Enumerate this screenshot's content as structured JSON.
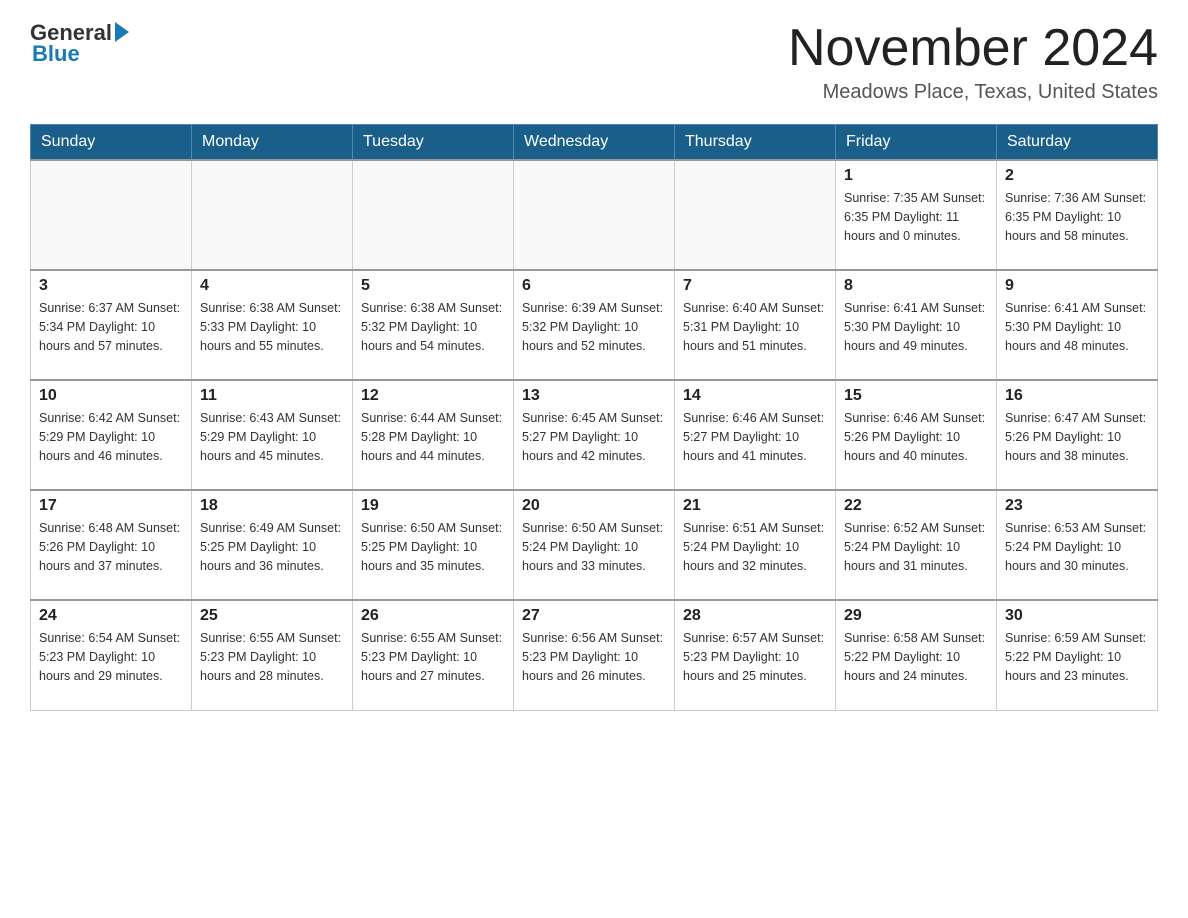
{
  "header": {
    "logo": {
      "general": "General",
      "blue": "Blue"
    },
    "title": "November 2024",
    "location": "Meadows Place, Texas, United States"
  },
  "weekdays": [
    "Sunday",
    "Monday",
    "Tuesday",
    "Wednesday",
    "Thursday",
    "Friday",
    "Saturday"
  ],
  "weeks": [
    [
      {
        "day": "",
        "info": ""
      },
      {
        "day": "",
        "info": ""
      },
      {
        "day": "",
        "info": ""
      },
      {
        "day": "",
        "info": ""
      },
      {
        "day": "",
        "info": ""
      },
      {
        "day": "1",
        "info": "Sunrise: 7:35 AM\nSunset: 6:35 PM\nDaylight: 11 hours and 0 minutes."
      },
      {
        "day": "2",
        "info": "Sunrise: 7:36 AM\nSunset: 6:35 PM\nDaylight: 10 hours and 58 minutes."
      }
    ],
    [
      {
        "day": "3",
        "info": "Sunrise: 6:37 AM\nSunset: 5:34 PM\nDaylight: 10 hours and 57 minutes."
      },
      {
        "day": "4",
        "info": "Sunrise: 6:38 AM\nSunset: 5:33 PM\nDaylight: 10 hours and 55 minutes."
      },
      {
        "day": "5",
        "info": "Sunrise: 6:38 AM\nSunset: 5:32 PM\nDaylight: 10 hours and 54 minutes."
      },
      {
        "day": "6",
        "info": "Sunrise: 6:39 AM\nSunset: 5:32 PM\nDaylight: 10 hours and 52 minutes."
      },
      {
        "day": "7",
        "info": "Sunrise: 6:40 AM\nSunset: 5:31 PM\nDaylight: 10 hours and 51 minutes."
      },
      {
        "day": "8",
        "info": "Sunrise: 6:41 AM\nSunset: 5:30 PM\nDaylight: 10 hours and 49 minutes."
      },
      {
        "day": "9",
        "info": "Sunrise: 6:41 AM\nSunset: 5:30 PM\nDaylight: 10 hours and 48 minutes."
      }
    ],
    [
      {
        "day": "10",
        "info": "Sunrise: 6:42 AM\nSunset: 5:29 PM\nDaylight: 10 hours and 46 minutes."
      },
      {
        "day": "11",
        "info": "Sunrise: 6:43 AM\nSunset: 5:29 PM\nDaylight: 10 hours and 45 minutes."
      },
      {
        "day": "12",
        "info": "Sunrise: 6:44 AM\nSunset: 5:28 PM\nDaylight: 10 hours and 44 minutes."
      },
      {
        "day": "13",
        "info": "Sunrise: 6:45 AM\nSunset: 5:27 PM\nDaylight: 10 hours and 42 minutes."
      },
      {
        "day": "14",
        "info": "Sunrise: 6:46 AM\nSunset: 5:27 PM\nDaylight: 10 hours and 41 minutes."
      },
      {
        "day": "15",
        "info": "Sunrise: 6:46 AM\nSunset: 5:26 PM\nDaylight: 10 hours and 40 minutes."
      },
      {
        "day": "16",
        "info": "Sunrise: 6:47 AM\nSunset: 5:26 PM\nDaylight: 10 hours and 38 minutes."
      }
    ],
    [
      {
        "day": "17",
        "info": "Sunrise: 6:48 AM\nSunset: 5:26 PM\nDaylight: 10 hours and 37 minutes."
      },
      {
        "day": "18",
        "info": "Sunrise: 6:49 AM\nSunset: 5:25 PM\nDaylight: 10 hours and 36 minutes."
      },
      {
        "day": "19",
        "info": "Sunrise: 6:50 AM\nSunset: 5:25 PM\nDaylight: 10 hours and 35 minutes."
      },
      {
        "day": "20",
        "info": "Sunrise: 6:50 AM\nSunset: 5:24 PM\nDaylight: 10 hours and 33 minutes."
      },
      {
        "day": "21",
        "info": "Sunrise: 6:51 AM\nSunset: 5:24 PM\nDaylight: 10 hours and 32 minutes."
      },
      {
        "day": "22",
        "info": "Sunrise: 6:52 AM\nSunset: 5:24 PM\nDaylight: 10 hours and 31 minutes."
      },
      {
        "day": "23",
        "info": "Sunrise: 6:53 AM\nSunset: 5:24 PM\nDaylight: 10 hours and 30 minutes."
      }
    ],
    [
      {
        "day": "24",
        "info": "Sunrise: 6:54 AM\nSunset: 5:23 PM\nDaylight: 10 hours and 29 minutes."
      },
      {
        "day": "25",
        "info": "Sunrise: 6:55 AM\nSunset: 5:23 PM\nDaylight: 10 hours and 28 minutes."
      },
      {
        "day": "26",
        "info": "Sunrise: 6:55 AM\nSunset: 5:23 PM\nDaylight: 10 hours and 27 minutes."
      },
      {
        "day": "27",
        "info": "Sunrise: 6:56 AM\nSunset: 5:23 PM\nDaylight: 10 hours and 26 minutes."
      },
      {
        "day": "28",
        "info": "Sunrise: 6:57 AM\nSunset: 5:23 PM\nDaylight: 10 hours and 25 minutes."
      },
      {
        "day": "29",
        "info": "Sunrise: 6:58 AM\nSunset: 5:22 PM\nDaylight: 10 hours and 24 minutes."
      },
      {
        "day": "30",
        "info": "Sunrise: 6:59 AM\nSunset: 5:22 PM\nDaylight: 10 hours and 23 minutes."
      }
    ]
  ]
}
